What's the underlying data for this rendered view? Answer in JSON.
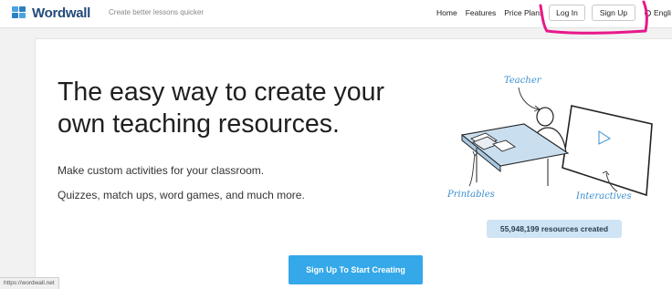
{
  "header": {
    "logo_text": "Wordwall",
    "tagline": "Create better lessons quicker",
    "nav": {
      "home": "Home",
      "features": "Features",
      "price_plans": "Price Plans"
    },
    "login_label": "Log In",
    "signup_label": "Sign Up",
    "language": "Engli",
    "highlight_color": "#e8188a"
  },
  "hero": {
    "headline": "The easy way to create your own teaching resources.",
    "sub1": "Make custom activities for your classroom.",
    "sub2": "Quizzes, match ups, word games, and much more."
  },
  "illustration": {
    "teacher_label": "Teacher",
    "printables_label": "Printables",
    "interactives_label": "Interactives"
  },
  "stats": {
    "resources_created": "55,948,199 resources created"
  },
  "cta": {
    "label": "Sign Up To Start Creating",
    "color": "#34a8e8"
  },
  "status_bar": {
    "url": "https://wordwall.net"
  }
}
